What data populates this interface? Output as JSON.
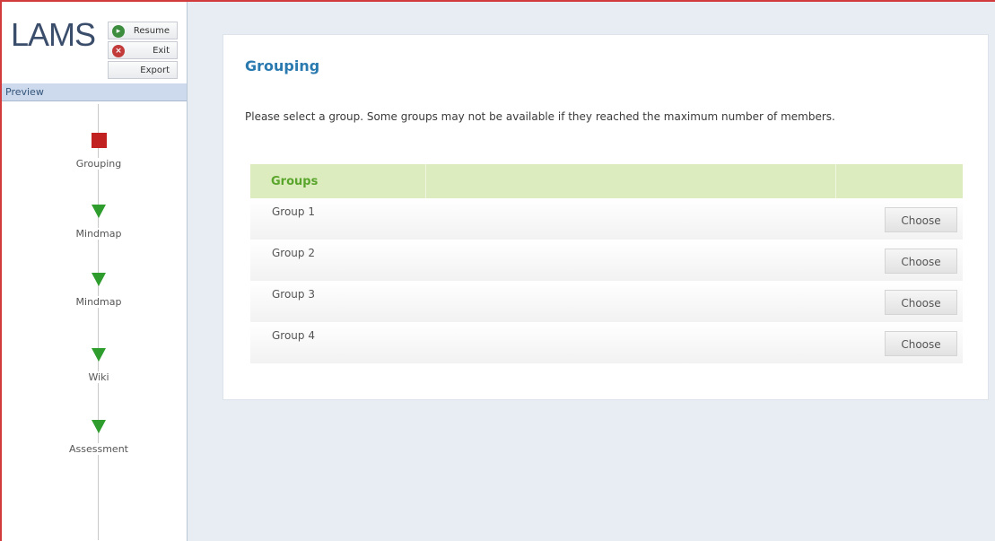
{
  "logo": "LAMS",
  "controls": {
    "resume_label": "Resume",
    "exit_label": "Exit",
    "export_label": "Export"
  },
  "sidebar": {
    "preview_label": "Preview",
    "steps": [
      {
        "label": "Grouping",
        "state": "current"
      },
      {
        "label": "Mindmap",
        "state": "pending"
      },
      {
        "label": "Mindmap",
        "state": "pending"
      },
      {
        "label": "Wiki",
        "state": "pending"
      },
      {
        "label": "Assessment",
        "state": "pending"
      }
    ]
  },
  "main": {
    "title": "Grouping",
    "instructions": "Please select a group. Some groups may not be available if they reached the maximum number of members.",
    "table_header": "Groups",
    "groups": [
      {
        "name": "Group 1",
        "button": "Choose"
      },
      {
        "name": "Group 2",
        "button": "Choose"
      },
      {
        "name": "Group 3",
        "button": "Choose"
      },
      {
        "name": "Group 4",
        "button": "Choose"
      }
    ]
  },
  "colors": {
    "accent_title": "#2a7ab0",
    "header_bg": "#dcecbf",
    "header_text": "#5aa52c",
    "current_step": "#c22121",
    "pending_step": "#2e9d2e"
  }
}
